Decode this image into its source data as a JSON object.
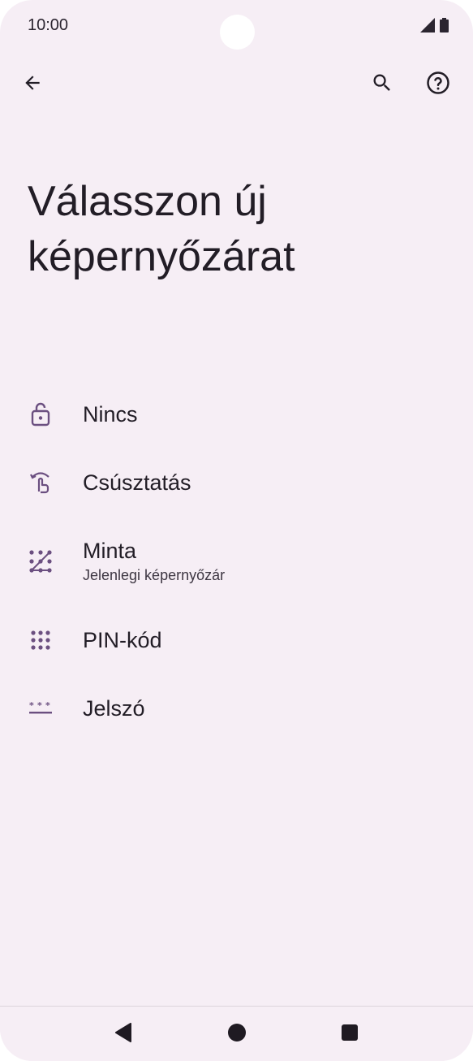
{
  "status_bar": {
    "time": "10:00"
  },
  "header": {
    "title": "Válasszon új képernyőzárat"
  },
  "options": [
    {
      "label": "Nincs",
      "sublabel": "",
      "icon": "lock-open-icon"
    },
    {
      "label": "Csúsztatás",
      "sublabel": "",
      "icon": "swipe-icon"
    },
    {
      "label": "Minta",
      "sublabel": "Jelenlegi képernyőzár",
      "icon": "pattern-icon"
    },
    {
      "label": "PIN-kód",
      "sublabel": "",
      "icon": "pin-dialpad-icon"
    },
    {
      "label": "Jelszó",
      "sublabel": "",
      "icon": "password-icon"
    }
  ],
  "icons": {
    "back": "back-arrow-icon",
    "search": "search-icon",
    "help": "help-icon"
  },
  "colors": {
    "background": "#f6eef5",
    "accent": "#6b4f80",
    "text": "#221d26"
  }
}
